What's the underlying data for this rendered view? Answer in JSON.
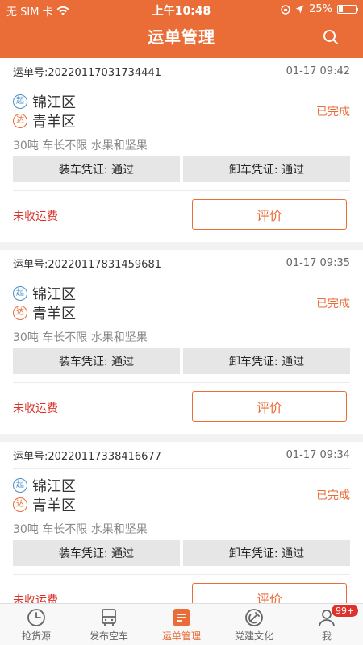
{
  "status_bar": {
    "carrier": "无 SIM 卡",
    "time": "上午10:48",
    "battery": "25%",
    "battery_fraction": 0.25
  },
  "header": {
    "title": "运单管理"
  },
  "orders": [
    {
      "no_label": "运单号:20220117031734441",
      "time": "01-17 09:42",
      "origin_badge": "起",
      "origin": "锦江区",
      "dest_badge": "达",
      "dest": "青羊区",
      "status": "已完成",
      "cargo": "30吨 车长不限 水果和坚果",
      "load_proof": "装车凭证: 通过",
      "unload_proof": "卸车凭证: 通过",
      "payment": "未收运费",
      "action": "评价"
    },
    {
      "no_label": "运单号:20220117831459681",
      "time": "01-17 09:35",
      "origin_badge": "起",
      "origin": "锦江区",
      "dest_badge": "达",
      "dest": "青羊区",
      "status": "已完成",
      "cargo": "30吨 车长不限 水果和坚果",
      "load_proof": "装车凭证: 通过",
      "unload_proof": "卸车凭证: 通过",
      "payment": "未收运费",
      "action": "评价"
    },
    {
      "no_label": "运单号:20220117338416677",
      "time": "01-17 09:34",
      "origin_badge": "起",
      "origin": "锦江区",
      "dest_badge": "达",
      "dest": "青羊区",
      "status": "已完成",
      "cargo": "30吨 车长不限 水果和坚果",
      "load_proof": "装车凭证: 通过",
      "unload_proof": "卸车凭证: 通过",
      "payment": "未收运费",
      "action": "评价"
    }
  ],
  "tabs": [
    {
      "label": "抢货源",
      "icon": "clock-icon"
    },
    {
      "label": "发布空车",
      "icon": "bus-icon"
    },
    {
      "label": "运单管理",
      "icon": "waybill-icon",
      "active": true
    },
    {
      "label": "党建文化",
      "icon": "party-emblem-icon"
    },
    {
      "label": "我",
      "icon": "user-icon",
      "badge": "99+"
    }
  ],
  "colors": {
    "accent": "#ea6d38",
    "alert": "#d9312a",
    "origin_blue": "#4a90c8"
  }
}
